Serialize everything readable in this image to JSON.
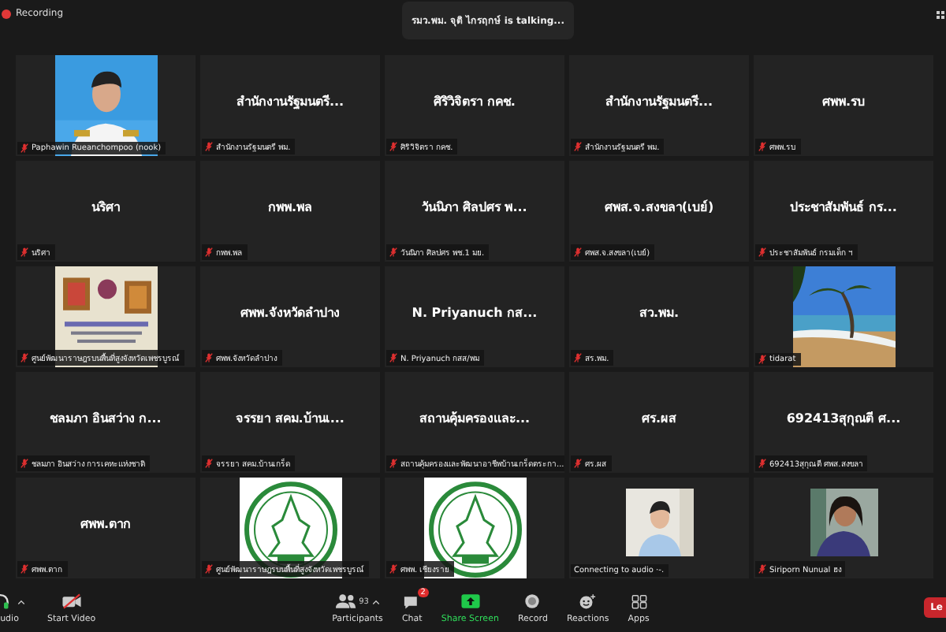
{
  "top_bar": {
    "recording": "Recording",
    "talking": "รมว.พม. จุติ ไกรฤกษ์ is talking..."
  },
  "tiles": [
    {
      "kind": "picture",
      "label": "Paphawin Rueanchompoo (nook)",
      "muted": true
    },
    {
      "kind": "name",
      "name": "สำนักงานรัฐมนตรี...",
      "label": "สำนักงานรัฐมนตรี พม.",
      "muted": true
    },
    {
      "kind": "name",
      "name": "ศิริวิจิตรา กคช.",
      "label": "ศิริวิจิตรา กคช.",
      "muted": true
    },
    {
      "kind": "name",
      "name": "สำนักงานรัฐมนตรี...",
      "label": "สำนักงานรัฐมนตรี พม.",
      "muted": true
    },
    {
      "kind": "name",
      "name": "ศพพ.รบ",
      "label": "ศพพ.รบ",
      "muted": true
    },
    {
      "kind": "name",
      "name": "นริศา",
      "label": "นริศา",
      "muted": true
    },
    {
      "kind": "name",
      "name": "กพพ.พล",
      "label": "กพพ.พล",
      "muted": true
    },
    {
      "kind": "name",
      "name": "วันนิภา ศิลปศร พ...",
      "label": "วันนิภา ศิลปศร พช.1 มย.",
      "muted": true
    },
    {
      "kind": "name",
      "name": "ศพส.จ.สงขลา(เบย์)",
      "label": "ศพส.จ.สงขลา(เบย์)",
      "muted": true
    },
    {
      "kind": "name",
      "name": "ประชาสัมพันธ์ กร...",
      "label": "ประชาสัมพันธ์ กรมเด็ก ฯ",
      "muted": true
    },
    {
      "kind": "picture",
      "label": "ศูนย์พัฒนาราษฎรบนพื้นที่สูงจังหวัดเพชรบูรณ์",
      "muted": true
    },
    {
      "kind": "name",
      "name": "ศพพ.จังหวัดลำปาง",
      "label": "ศพพ.จังหวัดลำปาง",
      "muted": true
    },
    {
      "kind": "name",
      "name": "N. Priyanuch กส...",
      "label": "N. Priyanuch กสส/พม",
      "muted": true
    },
    {
      "kind": "name",
      "name": "สว.พม.",
      "label": "สร.พม.",
      "muted": true
    },
    {
      "kind": "picture",
      "label": "tidarat",
      "muted": true
    },
    {
      "kind": "name",
      "name": "ชลมภา  อินสว่าง ก...",
      "label": "ชลมภา  อินสว่าง การเคหะแห่งชาติ",
      "muted": true
    },
    {
      "kind": "name",
      "name": "จรรยา สคม.บ้านเ...",
      "label": "จรรยา สคม.บ้านเกร็ด",
      "muted": true
    },
    {
      "kind": "name",
      "name": "สถานคุ้มครองและ...",
      "label": "สถานคุ้มครองและพัฒนาอาชีพบ้านเกร็ดตระกา...",
      "muted": true
    },
    {
      "kind": "name",
      "name": "ศร.ผส",
      "label": "ศร.ผส",
      "muted": true
    },
    {
      "kind": "name",
      "name": "692413สุกุณตี ศ...",
      "label": "692413สุกุณตี ศพส.สงขลา",
      "muted": true
    },
    {
      "kind": "name",
      "name": "ศพพ.ตาก",
      "label": "ศพพ.ตาก",
      "muted": true
    },
    {
      "kind": "picture",
      "label": "ศูนย์พัฒนาราษฎรบนพื้นที่สูงจังหวัดเพชรบูรณ์",
      "muted": true
    },
    {
      "kind": "picture",
      "label": "ศพพ. เชียงราย",
      "muted": true
    },
    {
      "kind": "picture",
      "label": "Connecting to audio ·-.",
      "muted": false
    },
    {
      "kind": "picture",
      "label": "Siriporn Nunual ฮง",
      "muted": true
    }
  ],
  "toolbar": [
    {
      "kind": "audio",
      "label": "udio"
    },
    {
      "kind": "video",
      "label": "Start Video",
      "off": true
    },
    {
      "kind": "participants",
      "label": "Participants",
      "count": "93"
    },
    {
      "kind": "chat",
      "label": "Chat",
      "badge": "2"
    },
    {
      "kind": "share",
      "label": "Share Screen"
    },
    {
      "kind": "record",
      "label": "Record"
    },
    {
      "kind": "reactions",
      "label": "Reactions"
    },
    {
      "kind": "apps",
      "label": "Apps"
    }
  ],
  "leave_button": "Le"
}
